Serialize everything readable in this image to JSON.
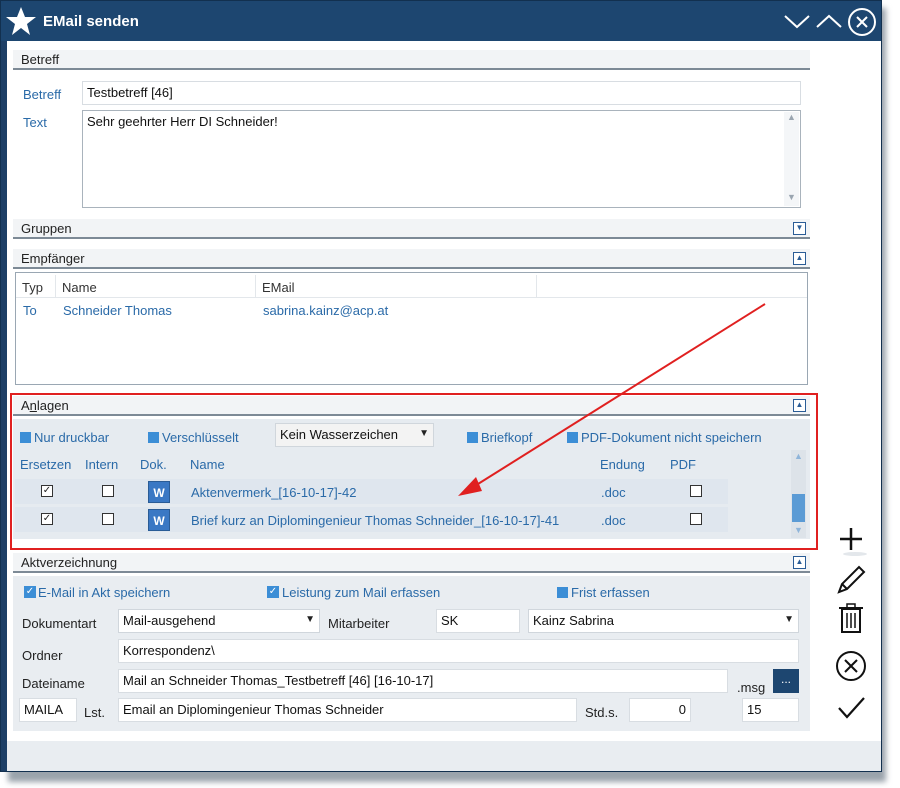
{
  "window": {
    "title": "EMail senden"
  },
  "betreff_section": {
    "header": "Betreff",
    "betreff_label": "Betreff",
    "betreff_value": "Testbetreff [46]",
    "text_label": "Text",
    "text_value": "Sehr geehrter Herr DI Schneider!"
  },
  "gruppen_section": {
    "header": "Gruppen"
  },
  "empfaenger_section": {
    "header": "Empfänger",
    "columns": [
      "Typ",
      "Name",
      "EMail"
    ],
    "rows": [
      {
        "typ": "To",
        "name": "Schneider Thomas",
        "email": "sabrina.kainz@acp.at"
      }
    ]
  },
  "anlagen_section": {
    "header_prefix": "A",
    "header_underline": "n",
    "header_suffix": "lagen",
    "options": {
      "nur_druckbar": "Nur druckbar",
      "verschluesselt": "Verschlüsselt",
      "wasserzeichen": "Kein Wasserzeichen",
      "briefkopf": "Briefkopf",
      "pdf_nicht_speichern": "PDF-Dokument nicht speichern"
    },
    "columns": [
      "Ersetzen",
      "Intern",
      "Dok.",
      "Name",
      "Endung",
      "PDF"
    ],
    "rows": [
      {
        "ersetzen": true,
        "intern": false,
        "name": "Aktenvermerk_[16-10-17]-42",
        "endung": ".doc",
        "pdf": false
      },
      {
        "ersetzen": true,
        "intern": false,
        "name": "Brief kurz an Diplomingenieur Thomas Schneider_[16-10-17]-41",
        "endung": ".doc",
        "pdf": false
      }
    ]
  },
  "akt_section": {
    "header": "Aktverzeichnung",
    "email_in_akt": "E-Mail in Akt speichern",
    "leistung": "Leistung zum Mail erfassen",
    "frist": "Frist erfassen",
    "dokumentart_label": "Dokumentart",
    "dokumentart_value": "Mail-ausgehend",
    "mitarbeiter_label": "Mitarbeiter",
    "mitarbeiter_code": "SK",
    "mitarbeiter_name": "Kainz Sabrina",
    "ordner_label": "Ordner",
    "ordner_value": "Korrespondenz\\",
    "dateiname_label": "Dateiname",
    "dateiname_value": "Mail an Schneider Thomas_Testbetreff [46] [16-10-17]",
    "dateiname_ext": ".msg",
    "browse_label": "...",
    "lst_code": "MAILA",
    "lst_label": "Lst.",
    "lst_text": "Email an Diplomingenieur Thomas Schneider",
    "stds_label": "Std.s.",
    "stds_value": "0",
    "value_15": "15"
  },
  "colors": {
    "titlebar": "#1d4670",
    "accent_blue": "#3c8ed6",
    "label_blue": "#2a6aa8",
    "highlight_red": "#e02020"
  },
  "icons": [
    "star-icon",
    "chevron-down-icon",
    "chevron-up-icon",
    "close-circle-icon",
    "plus-icon",
    "pencil-icon",
    "trash-icon",
    "cancel-icon",
    "check-icon",
    "word-doc-icon"
  ]
}
